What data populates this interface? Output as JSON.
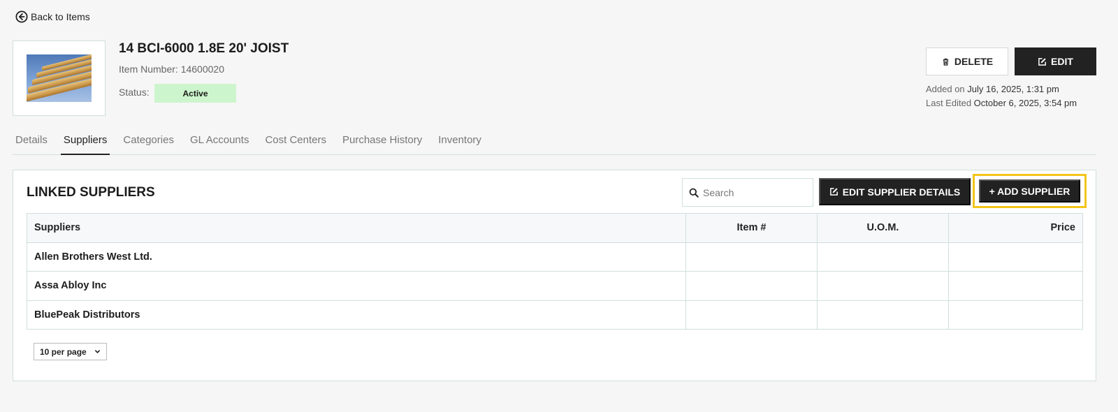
{
  "nav": {
    "back_label": "Back to Items"
  },
  "item": {
    "title": "14 BCI-6000 1.8E 20' JOIST",
    "item_number": "Item Number: 14600020",
    "status_label": "Status:",
    "status_value": "Active"
  },
  "actions": {
    "delete_label": "DELETE",
    "edit_label": "EDIT"
  },
  "meta": {
    "added_prefix": "Added on",
    "added_value": "July 16, 2025, 1:31 pm",
    "edited_prefix": "Last Edited",
    "edited_value": "October 6, 2025, 3:54 pm"
  },
  "tabs": [
    {
      "label": "Details",
      "active": false
    },
    {
      "label": "Suppliers",
      "active": true
    },
    {
      "label": "Categories",
      "active": false
    },
    {
      "label": "GL Accounts",
      "active": false
    },
    {
      "label": "Cost Centers",
      "active": false
    },
    {
      "label": "Purchase History",
      "active": false
    },
    {
      "label": "Inventory",
      "active": false
    }
  ],
  "suppliers_panel": {
    "title": "LINKED SUPPLIERS",
    "search_placeholder": "Search",
    "edit_supplier_details_label": "EDIT SUPPLIER DETAILS",
    "add_supplier_label": "+ ADD SUPPLIER",
    "highlight_color": "#f2c51b",
    "columns": [
      "Suppliers",
      "Item #",
      "U.O.M.",
      "Price"
    ],
    "rows": [
      [
        "Allen Brothers West Ltd.",
        "",
        "",
        ""
      ],
      [
        "Assa Abloy Inc",
        "",
        "",
        ""
      ],
      [
        "BluePeak Distributors",
        "",
        "",
        ""
      ]
    ],
    "per_page_label": "10 per page"
  }
}
